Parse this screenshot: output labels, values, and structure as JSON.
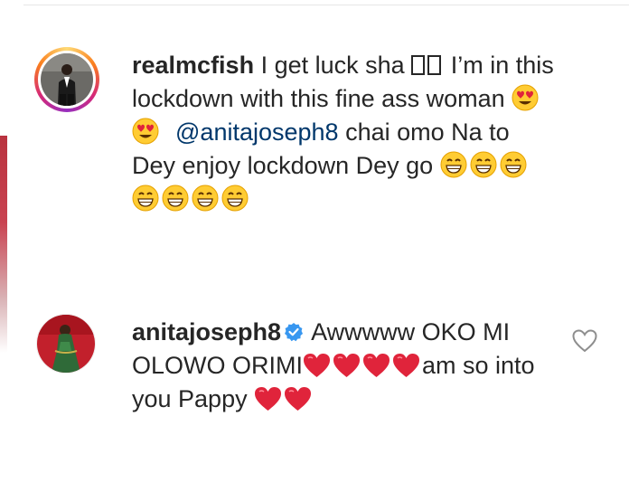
{
  "comments": [
    {
      "username": "realmcfish",
      "text_before_boxes": "I get luck sha",
      "boxes": [
        "missing-glyph",
        "missing-glyph"
      ],
      "text_a": "I’m in this lockdown with this fine ass woman",
      "emojis_a": [
        "heart-eyes-emoji",
        "heart-eyes-emoji"
      ],
      "mention": "@anitajoseph8",
      "text_b": "chai omo Na to Dey enjoy lockdown Dey go",
      "emojis_b": [
        "grinning-emoji",
        "grinning-emoji",
        "grinning-emoji",
        "grinning-emoji",
        "grinning-emoji",
        "grinning-emoji",
        "grinning-emoji"
      ],
      "avatar": "man-in-suit-avatar",
      "story_ring": true
    },
    {
      "username": "anitajoseph8",
      "verified": true,
      "text_a": "Awwwww OKO MI OLOWO ORIMI",
      "hearts_a": [
        "red-heart-emoji",
        "red-heart-emoji",
        "red-heart-emoji",
        "red-heart-emoji"
      ],
      "text_b": "am so into you Pappy",
      "hearts_b": [
        "red-heart-emoji",
        "red-heart-emoji"
      ],
      "avatar": "woman-green-dress-avatar",
      "like_icon": "heart-outline-icon"
    }
  ],
  "colors": {
    "text": "#262626",
    "mention": "#00376b",
    "verified": "#3897f0",
    "heart": "#e0243b",
    "like_outline": "#8e8e8e"
  }
}
